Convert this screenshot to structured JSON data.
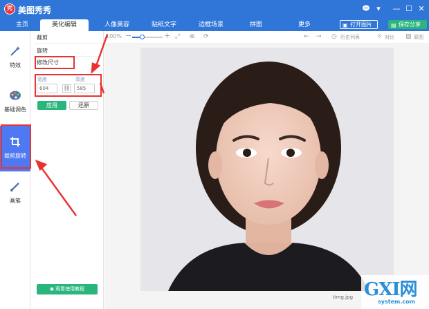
{
  "app": {
    "logo_glyph": "秀",
    "title": "美图秀秀"
  },
  "window_controls": {
    "chat_icon": "chat-bubble-icon",
    "menu_glyph": "▾",
    "minimize_glyph": "—",
    "maximize_glyph": "☐",
    "close_glyph": "✕"
  },
  "tabs": [
    {
      "label": "主页"
    },
    {
      "label": "美化编辑",
      "active": true
    },
    {
      "label": "人像美容"
    },
    {
      "label": "贴纸文字"
    },
    {
      "label": "边框场景"
    },
    {
      "label": "拼图"
    },
    {
      "label": "更多"
    }
  ],
  "top_buttons": {
    "open_image": "打开图片",
    "save_share": "保存分享"
  },
  "left_rail": [
    {
      "label": "特效",
      "icon": "magic-wand-icon"
    },
    {
      "label": "基础调色",
      "icon": "palette-icon"
    },
    {
      "label": "裁剪旋转",
      "icon": "crop-icon",
      "active": true
    },
    {
      "label": "画笔",
      "icon": "brush-icon"
    }
  ],
  "tool_panel": {
    "crop_label": "裁剪",
    "rotate_label": "旋转",
    "resize_label": "修改尺寸",
    "width_label": "宽度",
    "height_label": "高度",
    "width_value": "604",
    "height_value": "585",
    "apply_label": "应用",
    "restore_label": "还原",
    "tutorial_label": "观看使用教程"
  },
  "toolbar2": {
    "zoom": "100%",
    "history_label": "历史列表",
    "compare_label": "对比",
    "original_label": "原图"
  },
  "canvas": {
    "filename": "timg.jpg"
  },
  "watermark": {
    "big": "GXI网",
    "small": "system.com"
  },
  "colors": {
    "brand_blue": "#2f76d8",
    "accent_green": "#2ab57d",
    "rail_active": "#4e79f2",
    "callout_red": "#e83333"
  }
}
